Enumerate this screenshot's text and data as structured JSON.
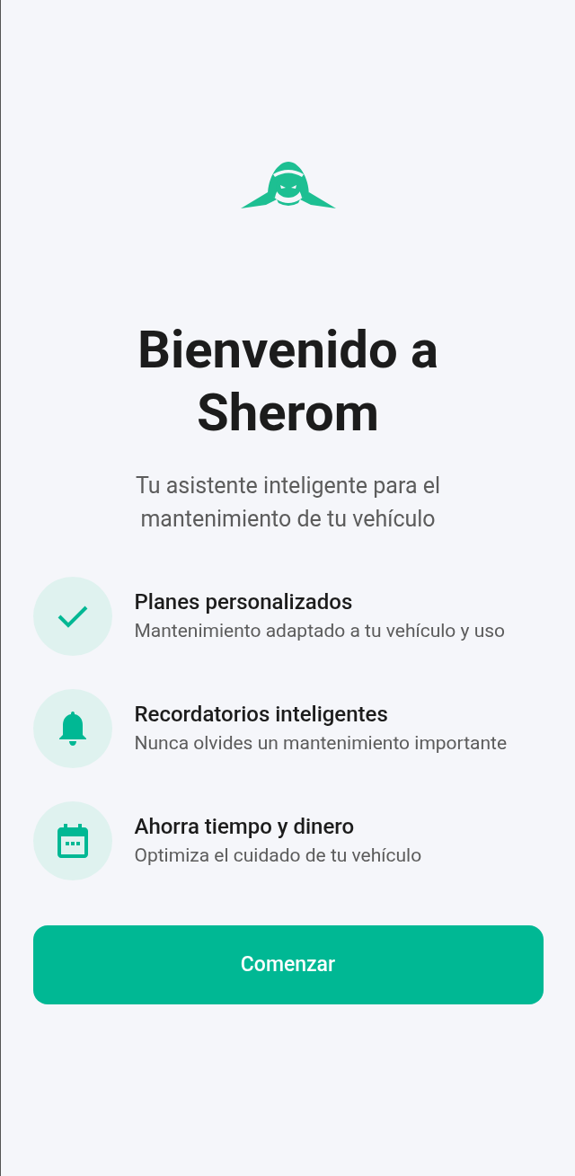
{
  "title": "Bienvenido a Sherom",
  "subtitle": "Tu asistente inteligente para el mantenimiento de tu vehículo",
  "features": [
    {
      "kind": "check",
      "title": "Planes personalizados",
      "description": "Mantenimiento adaptado a tu vehículo y uso"
    },
    {
      "kind": "bell",
      "title": "Recordatorios inteligentes",
      "description": "Nunca olvides un mantenimiento importante"
    },
    {
      "kind": "calendar",
      "title": "Ahorra tiempo y dinero",
      "description": "Optimiza el cuidado de tu vehículo"
    }
  ],
  "button": "Comenzar"
}
